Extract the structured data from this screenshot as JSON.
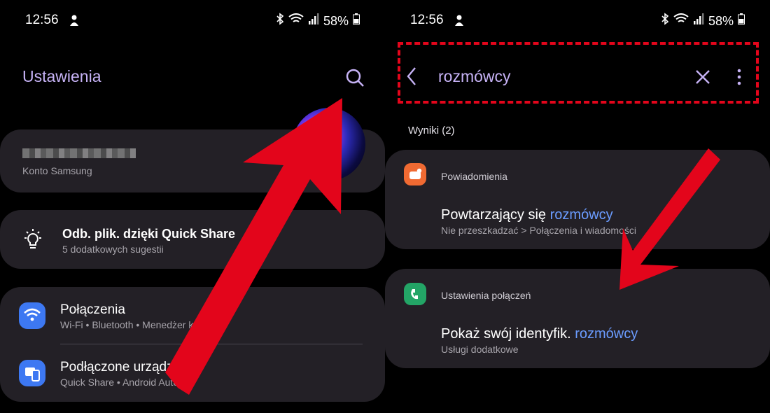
{
  "left": {
    "status": {
      "time": "12:56",
      "battery": "58%"
    },
    "title": "Ustawienia",
    "account": {
      "label": "Konto Samsung"
    },
    "suggestion": {
      "title": "Odb. plik. dzięki Quick Share",
      "subtitle": "5 dodatkowych sugestii"
    },
    "items": [
      {
        "title": "Połączenia",
        "subtitle": "Wi-Fi  •  Bluetooth  •  Menedżer kart SIM"
      },
      {
        "title": "Podłączone urządzenia",
        "subtitle": "Quick Share  •  Android Auto"
      }
    ]
  },
  "right": {
    "status": {
      "time": "12:56",
      "battery": "58%"
    },
    "search": {
      "query": "rozmówcy"
    },
    "results_label": "Wyniki (2)",
    "results": [
      {
        "category": "Powiadomienia",
        "title_prefix": "Powtarzający się",
        "title_highlight": "rozmówcy",
        "path": "Nie przeszkadzać > Połączenia i wiadomości"
      },
      {
        "category": "Ustawienia połączeń",
        "title_prefix": "Pokaż swój identyfik.",
        "title_highlight": "rozmówcy",
        "path": "Usługi dodatkowe"
      }
    ]
  },
  "colors": {
    "accent": "#c6b2f5",
    "highlight": "#6b9cff",
    "annotation": "#e3051b",
    "card": "#232026"
  }
}
